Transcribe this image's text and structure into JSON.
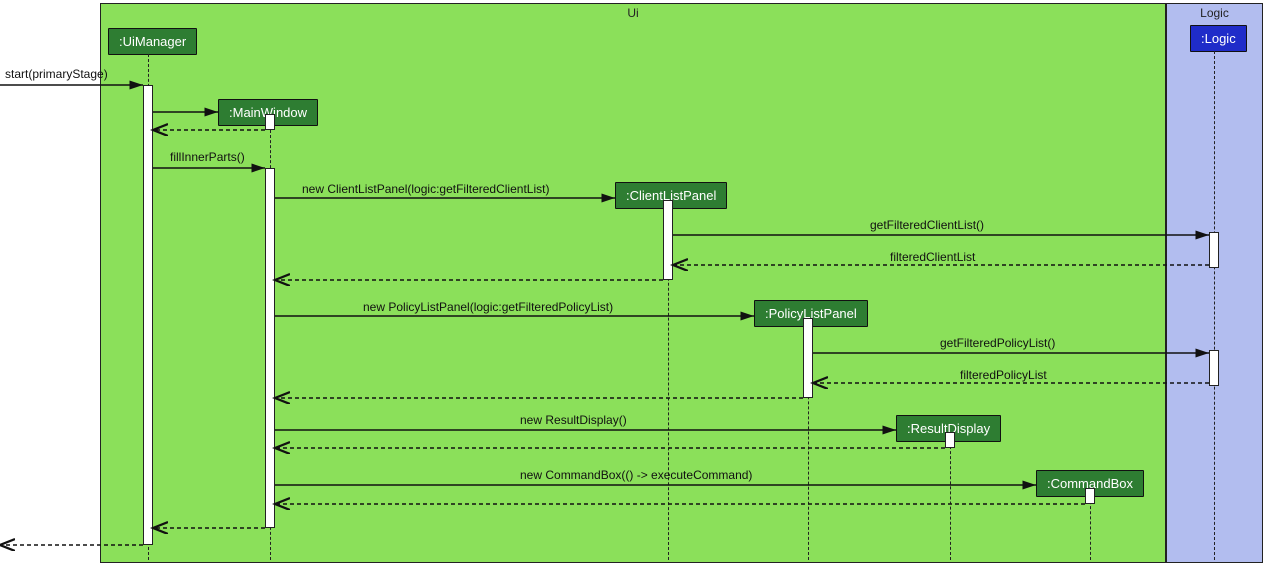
{
  "frames": {
    "ui": {
      "label": "Ui"
    },
    "logic": {
      "label": "Logic"
    }
  },
  "participants": {
    "uiManager": ":UiManager",
    "mainWindow": ":MainWindow",
    "clientListPanel": ":ClientListPanel",
    "policyListPanel": ":PolicyListPanel",
    "resultDisplay": ":ResultDisplay",
    "commandBox": ":CommandBox",
    "logic": ":Logic"
  },
  "messages": {
    "start": "start(primaryStage)",
    "fillInnerParts": "fillInnerParts()",
    "newClientListPanel": "new ClientListPanel(logic:getFilteredClientList)",
    "getFilteredClientList": "getFilteredClientList()",
    "filteredClientList": "filteredClientList",
    "newPolicyListPanel": "new PolicyListPanel(logic:getFilteredPolicyList)",
    "getFilteredPolicyList": "getFilteredPolicyList()",
    "filteredPolicyList": "filteredPolicyList",
    "newResultDisplay": "new ResultDisplay()",
    "newCommandBox": "new CommandBox(() -> executeCommand)"
  }
}
